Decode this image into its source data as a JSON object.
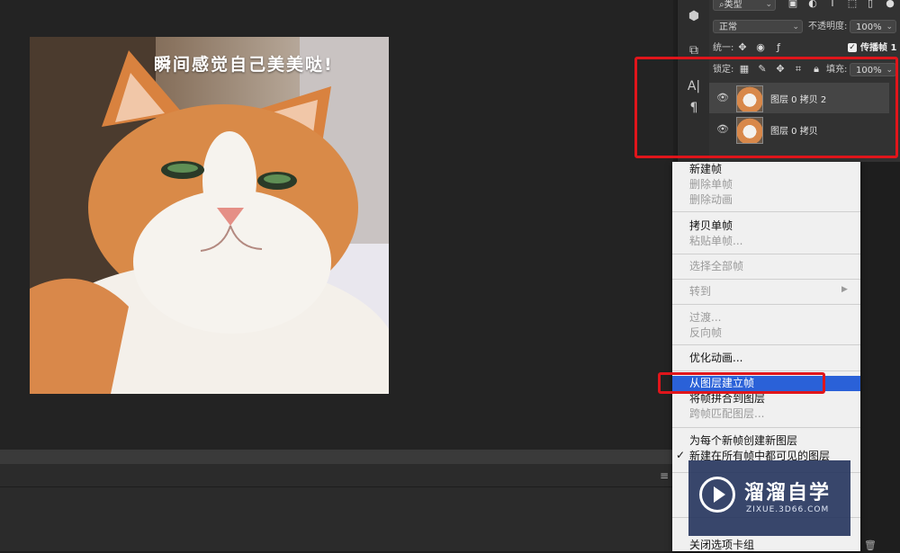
{
  "canvas": {
    "image_caption": "瞬间感觉自己美美哒!"
  },
  "layers_panel": {
    "filter_kind": "类型",
    "blend_mode": "正常",
    "opacity_label": "不透明度:",
    "opacity_value": "100%",
    "unify_label": "统一:",
    "propagate_label": "传播帧 1",
    "lock_label": "锁定:",
    "fill_label": "填充:",
    "fill_value": "100%",
    "layers": [
      {
        "name": "图层 0 拷贝 2",
        "selected": true
      },
      {
        "name": "图层 0 拷贝",
        "selected": false
      }
    ]
  },
  "context_menu": {
    "items": [
      {
        "label": "新建帧",
        "enabled": true
      },
      {
        "label": "删除单帧",
        "enabled": false
      },
      {
        "label": "删除动画",
        "enabled": false
      },
      {
        "label": "拷贝单帧",
        "enabled": true
      },
      {
        "label": "粘贴单帧...",
        "enabled": false
      },
      {
        "label": "选择全部帧",
        "enabled": false
      },
      {
        "label": "转到",
        "enabled": false
      },
      {
        "label": "过渡...",
        "enabled": false
      },
      {
        "label": "反向帧",
        "enabled": false
      },
      {
        "label": "优化动画...",
        "enabled": true
      },
      {
        "label": "从图层建立帧",
        "enabled": true,
        "highlighted": true
      },
      {
        "label": "将帧拼合到图层",
        "enabled": true
      },
      {
        "label": "跨帧匹配图层...",
        "enabled": false
      },
      {
        "label": "为每个新帧创建新图层",
        "enabled": true
      },
      {
        "label": "新建在所有帧中都可见的图层",
        "enabled": true,
        "checked": true
      },
      {
        "label": "关闭选项卡组",
        "enabled": true
      }
    ]
  },
  "watermark": {
    "title": "溜溜自学",
    "subtitle": "ZIXUE.3D66.COM"
  },
  "colors": {
    "highlight": "#2a61d8",
    "annotation_red": "#e0151b"
  }
}
